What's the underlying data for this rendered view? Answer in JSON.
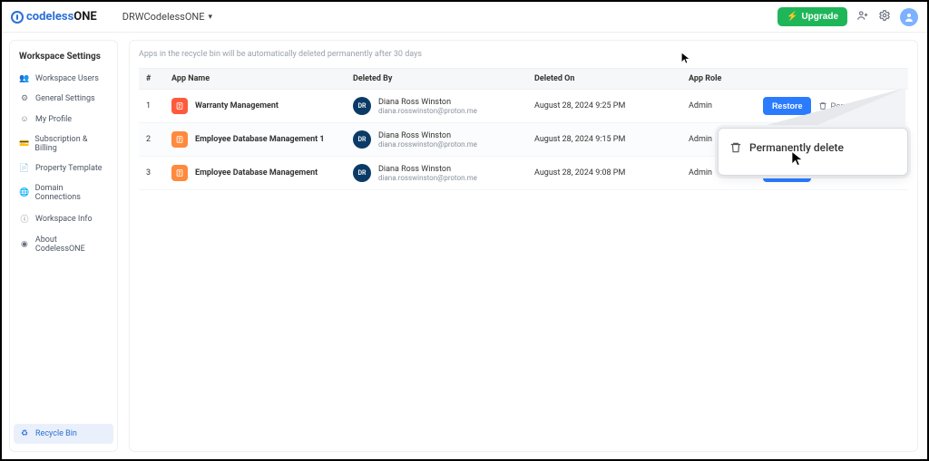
{
  "brand": {
    "name_a": "codeless",
    "name_b": "ONE"
  },
  "workspace": {
    "name": "DRWCodelessONE"
  },
  "topbar": {
    "upgrade": "Upgrade"
  },
  "sidebar": {
    "title": "Workspace Settings",
    "items": [
      {
        "label": "Workspace Users",
        "icon": "👥"
      },
      {
        "label": "General Settings",
        "icon": "⚙"
      },
      {
        "label": "My Profile",
        "icon": "☺"
      },
      {
        "label": "Subscription & Billing",
        "icon": "💳"
      },
      {
        "label": "Property Template",
        "icon": "📄"
      },
      {
        "label": "Domain Connections",
        "icon": "🌐"
      },
      {
        "label": "Workspace Info",
        "icon": "ⓘ"
      },
      {
        "label": "About CodelessONE",
        "icon": "◉"
      }
    ],
    "recycle": {
      "label": "Recycle Bin",
      "icon": "♻"
    }
  },
  "main": {
    "notice": "Apps in the recycle bin will be automatically deleted permanently after 30 days",
    "columns": {
      "idx": "#",
      "app": "App Name",
      "deletedBy": "Deleted By",
      "deletedOn": "Deleted On",
      "role": "App Role"
    },
    "actions": {
      "restore": "Restore",
      "perm": "Permanently delete"
    },
    "rows": [
      {
        "idx": "1",
        "app": "Warranty Management",
        "iconClass": "red",
        "userInitials": "DR",
        "userName": "Diana Ross Winston",
        "userEmail": "diana.rosswinston@proton.me",
        "deletedOn": "August 28, 2024 9:25 PM",
        "role": "Admin"
      },
      {
        "idx": "2",
        "app": "Employee Database Management 1",
        "iconClass": "orange",
        "userInitials": "DR",
        "userName": "Diana Ross Winston",
        "userEmail": "diana.rosswinston@proton.me",
        "deletedOn": "August 28, 2024 9:15 PM",
        "role": "Admin"
      },
      {
        "idx": "3",
        "app": "Employee Database Management",
        "iconClass": "orange",
        "userInitials": "DR",
        "userName": "Diana Ross Winston",
        "userEmail": "diana.rosswinston@proton.me",
        "deletedOn": "August 28, 2024 9:08 PM",
        "role": "Admin"
      }
    ]
  },
  "callout": {
    "label": "Permanently delete"
  }
}
